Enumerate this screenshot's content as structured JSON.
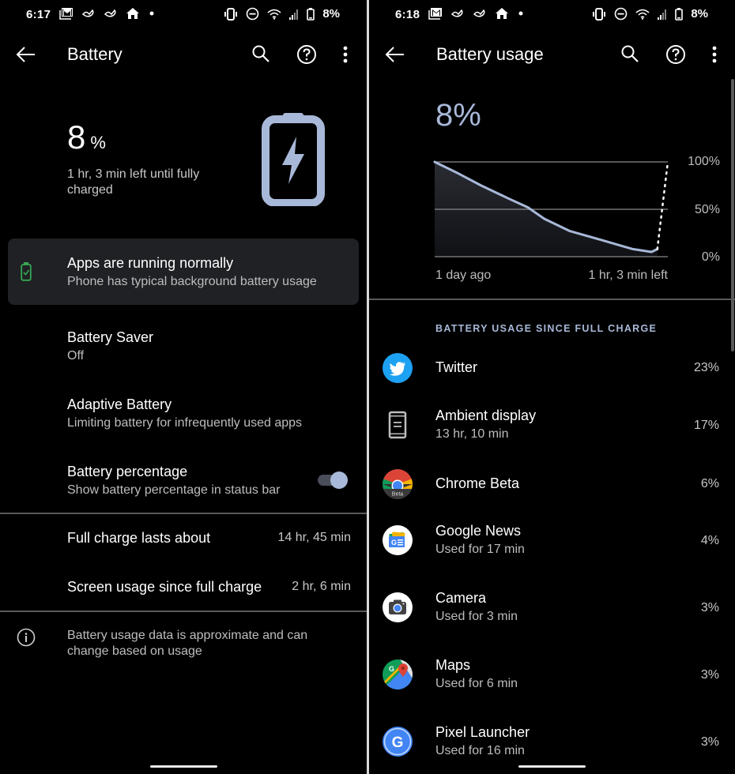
{
  "left": {
    "status": {
      "time": "6:17",
      "notification_icons": [
        "gmail-icon",
        "bird-icon",
        "bird-icon",
        "home-icon",
        "dot-icon"
      ],
      "system_icons": [
        "vibrate-icon",
        "dnd-icon",
        "wifi-icon",
        "signal-icon",
        "battery-icon"
      ],
      "battery_percent": "8%"
    },
    "toolbar": {
      "title": "Battery"
    },
    "summary": {
      "level": "8",
      "level_unit": "%",
      "time_left": "1 hr, 3 min left until fully charged",
      "battery_color": "#a8b8d8"
    },
    "status_card": {
      "title": "Apps are running normally",
      "subtitle": "Phone has typical background battery usage",
      "icon_color": "#34a853"
    },
    "prefs": [
      {
        "title": "Battery Saver",
        "subtitle": "Off"
      },
      {
        "title": "Adaptive Battery",
        "subtitle": "Limiting battery for infrequently used apps"
      },
      {
        "title": "Battery percentage",
        "subtitle": "Show battery percentage in status bar",
        "toggle_on": true
      }
    ],
    "stats": [
      {
        "label": "Full charge lasts about",
        "value": "14 hr, 45 min"
      },
      {
        "label": "Screen usage since full charge",
        "value": "2 hr, 6 min"
      }
    ],
    "info": "Battery usage data is approximate and can change based on usage"
  },
  "right": {
    "status": {
      "time": "6:18",
      "battery_percent": "8%"
    },
    "toolbar": {
      "title": "Battery usage"
    },
    "level": "8%",
    "section_header": "BATTERY USAGE SINCE FULL CHARGE",
    "apps": [
      {
        "name": "Twitter",
        "detail": "",
        "percent": "23%",
        "icon": "twitter-icon"
      },
      {
        "name": "Ambient display",
        "detail": "13 hr, 10 min",
        "percent": "17%",
        "icon": "ambient-display-icon"
      },
      {
        "name": "Chrome Beta",
        "detail": "",
        "percent": "6%",
        "icon": "chrome-beta-icon",
        "badge": "Beta"
      },
      {
        "name": "Google News",
        "detail": "Used for 17 min",
        "percent": "4%",
        "icon": "google-news-icon"
      },
      {
        "name": "Camera",
        "detail": "Used for 3 min",
        "percent": "3%",
        "icon": "camera-icon"
      },
      {
        "name": "Maps",
        "detail": "Used for 6 min",
        "percent": "3%",
        "icon": "maps-icon"
      },
      {
        "name": "Pixel Launcher",
        "detail": "Used for 16 min",
        "percent": "3%",
        "icon": "pixel-launcher-icon"
      }
    ]
  },
  "chart_data": {
    "type": "line",
    "title": "",
    "xlabel": "",
    "ylabel": "",
    "x_tick_labels": [
      "1 day ago",
      "1 hr, 3 min left"
    ],
    "y_tick_labels": [
      "100%",
      "50%",
      "0%"
    ],
    "ylim": [
      0,
      100
    ],
    "grid": true,
    "series": [
      {
        "name": "Battery level (history)",
        "style": "solid-filled",
        "color": "#a8b8d8",
        "x": [
          0,
          0.1,
          0.2,
          0.32,
          0.4,
          0.47,
          0.58,
          0.71,
          0.85,
          0.93,
          0.955
        ],
        "y": [
          100,
          88,
          75,
          61,
          52,
          40,
          27,
          18,
          8,
          5,
          8
        ]
      },
      {
        "name": "Projected charge",
        "style": "dotted",
        "color": "#ffffff",
        "x": [
          0.955,
          1.0
        ],
        "y": [
          8,
          100
        ]
      }
    ]
  }
}
